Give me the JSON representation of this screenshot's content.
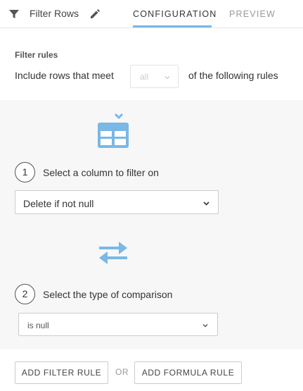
{
  "header": {
    "title": "Filter Rows",
    "tabs": [
      {
        "label": "CONFIGURATION",
        "active": true
      },
      {
        "label": "PREVIEW",
        "active": false
      }
    ],
    "active_tab_color": "#7ab8e6"
  },
  "rules": {
    "heading": "Filter rules",
    "include_prefix": "Include rows that meet",
    "match_value": "all",
    "include_suffix": "of the following rules"
  },
  "steps": [
    {
      "number": "1",
      "label": "Select a column to filter on",
      "selected_value": "Delete if not null"
    },
    {
      "number": "2",
      "label": "Select the type of comparison",
      "selected_value": "is null"
    }
  ],
  "actions": {
    "add_filter_rule": "ADD FILTER RULE",
    "or": "OR",
    "add_formula_rule": "ADD FORMULA RULE"
  },
  "icons": {
    "header": [
      "filter-icon",
      "pencil-icon"
    ],
    "step1_illustration": "table-icon",
    "step2_illustration": "swap-arrows-icon",
    "dropdown": "chevron-down-icon"
  },
  "colors": {
    "accent": "#7ab8e6",
    "panel_background": "#f7f7f7"
  }
}
